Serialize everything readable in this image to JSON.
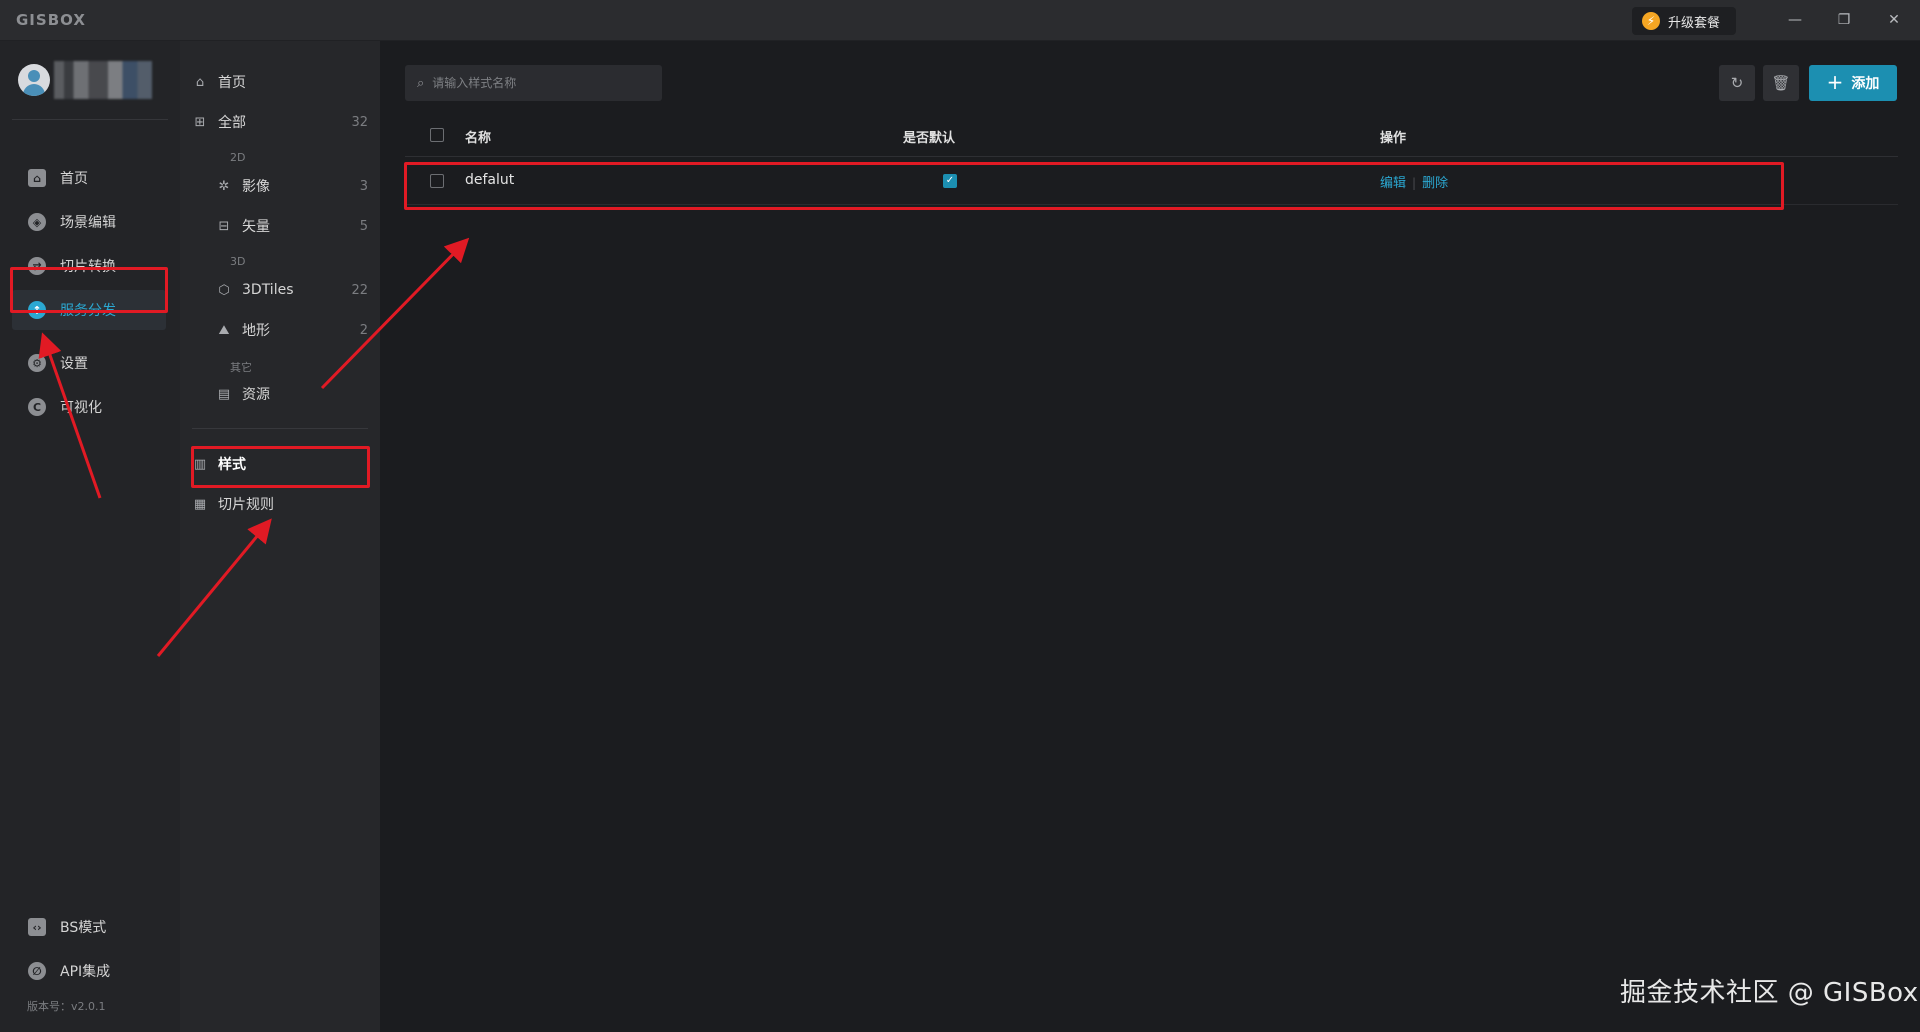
{
  "titlebar": {
    "logo": "GISBOX",
    "upgrade_label": "升级套餐",
    "minimize_glyph": "—",
    "restore_glyph": "❐",
    "close_glyph": "✕"
  },
  "sidebar": {
    "items": [
      {
        "label": "首页",
        "icon": "home-icon"
      },
      {
        "label": "场景编辑",
        "icon": "cube-icon"
      },
      {
        "label": "切片转换",
        "icon": "swap-icon"
      },
      {
        "label": "服务分发",
        "icon": "upload-cloud-icon",
        "active": true
      },
      {
        "label": "设置",
        "icon": "gear-icon"
      },
      {
        "label": "可视化",
        "icon": "chart-icon"
      }
    ],
    "bottom": [
      {
        "label": "BS模式",
        "icon": "code-icon"
      },
      {
        "label": "API集成",
        "icon": "api-icon"
      }
    ],
    "version": "版本号：v2.0.1"
  },
  "categories": {
    "home": "首页",
    "all": {
      "label": "全部",
      "count": "32"
    },
    "group_2d": "2D",
    "imagery": {
      "label": "影像",
      "count": "3"
    },
    "vector": {
      "label": "矢量",
      "count": "5"
    },
    "group_3d": "3D",
    "tiles3d": {
      "label": "3DTiles",
      "count": "22"
    },
    "terrain": {
      "label": "地形",
      "count": "2"
    },
    "group_other": "其它",
    "resources": {
      "label": "资源"
    },
    "style": {
      "label": "样式"
    },
    "tile_rules": {
      "label": "切片规则"
    }
  },
  "main": {
    "search_placeholder": "请输入样式名称",
    "add_label": "添加",
    "columns": {
      "name": "名称",
      "default": "是否默认",
      "actions": "操作"
    },
    "rows": [
      {
        "name": "defalut",
        "is_default": true,
        "edit": "编辑",
        "delete": "删除"
      }
    ]
  },
  "watermark": "掘金技术社区 @ GISBox",
  "colors": {
    "accent": "#1c8fb1",
    "annotation": "#e11a24"
  }
}
